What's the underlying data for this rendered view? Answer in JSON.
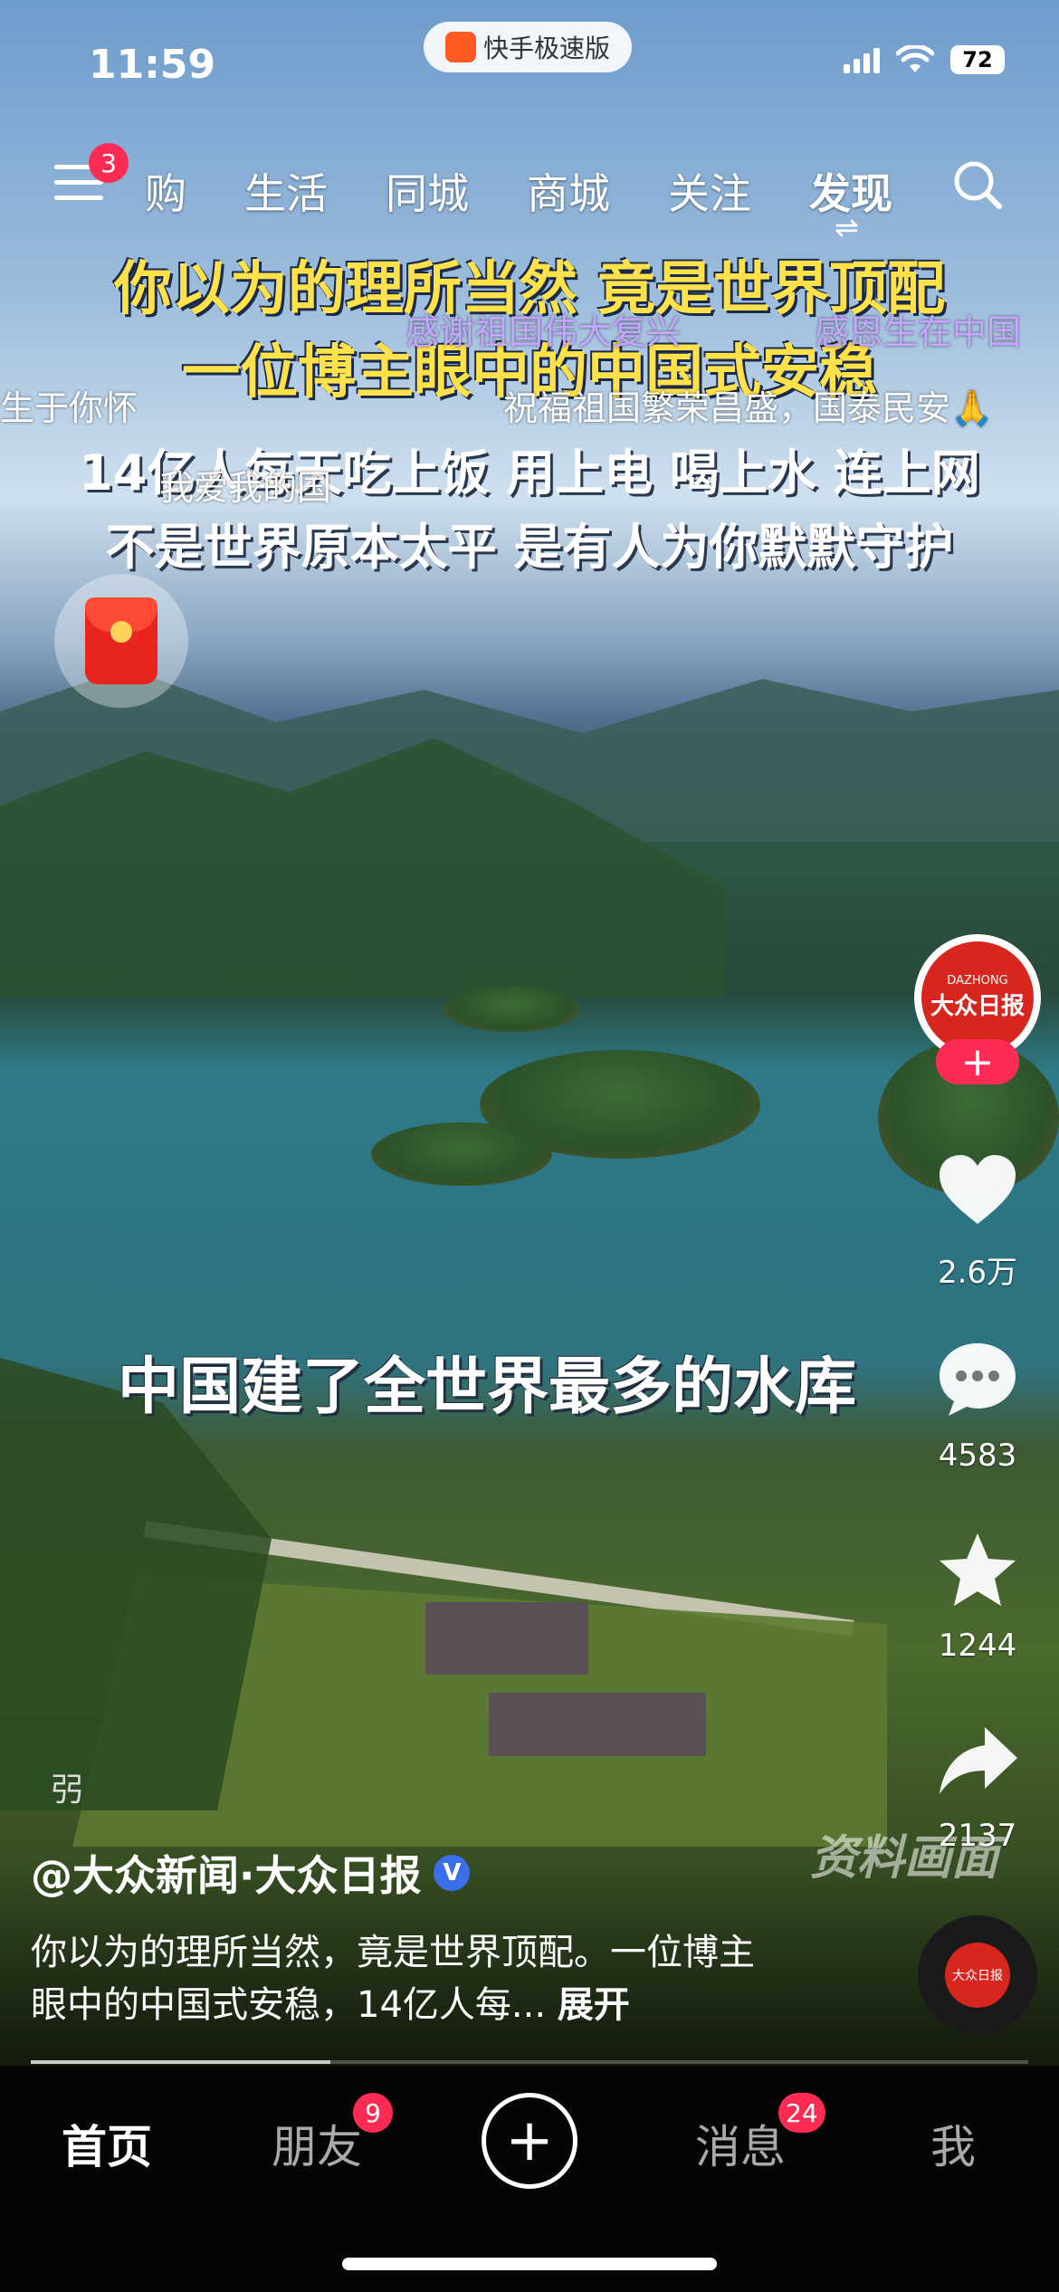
{
  "status_bar": {
    "time": "11:59",
    "app_pill": "快手极速版",
    "battery": "72"
  },
  "top_nav": {
    "menu_badge": "3",
    "tabs": [
      "购",
      "生活",
      "同城",
      "商城",
      "关注",
      "发现"
    ],
    "active_tab": "发现",
    "switch_glyph": "⇌"
  },
  "video": {
    "headline": [
      "你以为的理所当然 竟是世界顶配",
      "一位博主眼中的中国式安稳",
      "14亿人每天吃上饭 用上电 喝上水 连上网",
      "不是世界原本太平 是有人为你默默守护"
    ],
    "danmu": [
      "感谢祖国伟大复兴",
      "感恩生在中国",
      "生于你怀",
      "祝福祖国繁荣昌盛，国泰民安🙏",
      "我爱我的国"
    ],
    "mid_caption": "中国建了全世界最多的水库",
    "watermark": "资料画面",
    "sound_mark": "弜"
  },
  "side_actions": {
    "avatar_text": "大众日报",
    "avatar_sub": "DAZHONG",
    "follow_label": "+",
    "like_count": "2.6万",
    "comment_count": "4583",
    "favorite_count": "1244",
    "share_count": "2137"
  },
  "post": {
    "author": "@大众新闻·大众日报",
    "verified": "V",
    "description": "你以为的理所当然，竟是世界顶配。一位博主眼中的中国式安稳，14亿人每...",
    "expand": "展开"
  },
  "bottom_nav": {
    "home": "首页",
    "friends": "朋友",
    "friends_badge": "9",
    "create": "+",
    "messages": "消息",
    "messages_badge": "24",
    "me": "我"
  },
  "colors": {
    "accent": "#fe2c55",
    "headline_yellow": "#ffe14a",
    "danmu_purple": "#c7a6ff",
    "verified_blue": "#3a6fe8"
  }
}
